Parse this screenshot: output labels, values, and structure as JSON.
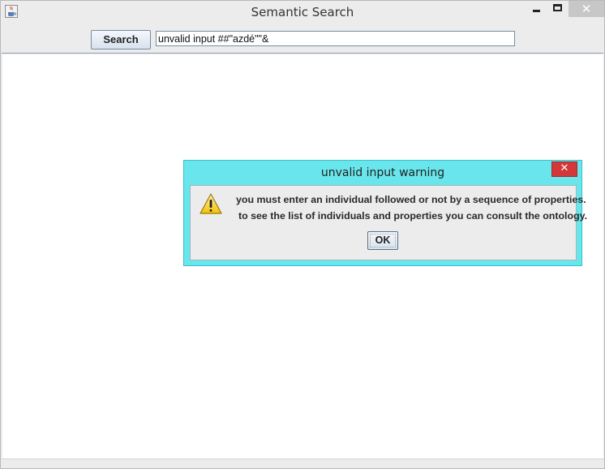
{
  "window": {
    "title": "Semantic Search",
    "close_glyph": "✕"
  },
  "toolbar": {
    "search_label": "Search",
    "search_value": "unvalid input ##\"azdé\"\"&"
  },
  "dialog": {
    "title": "unvalid input warning",
    "close_glyph": "✕",
    "message_line1": "you must enter an individual followed or not by a sequence of properties.",
    "message_line2": "to see the list of individuals and properties you can consult the ontology.",
    "ok_label": "OK"
  },
  "colors": {
    "dialog_frame": "#69e6ec",
    "dialog_close": "#d2383a",
    "warning": "#f2c200"
  },
  "icons": {
    "app": "java-coffee-cup-icon",
    "dialog": "warning-triangle-icon"
  }
}
